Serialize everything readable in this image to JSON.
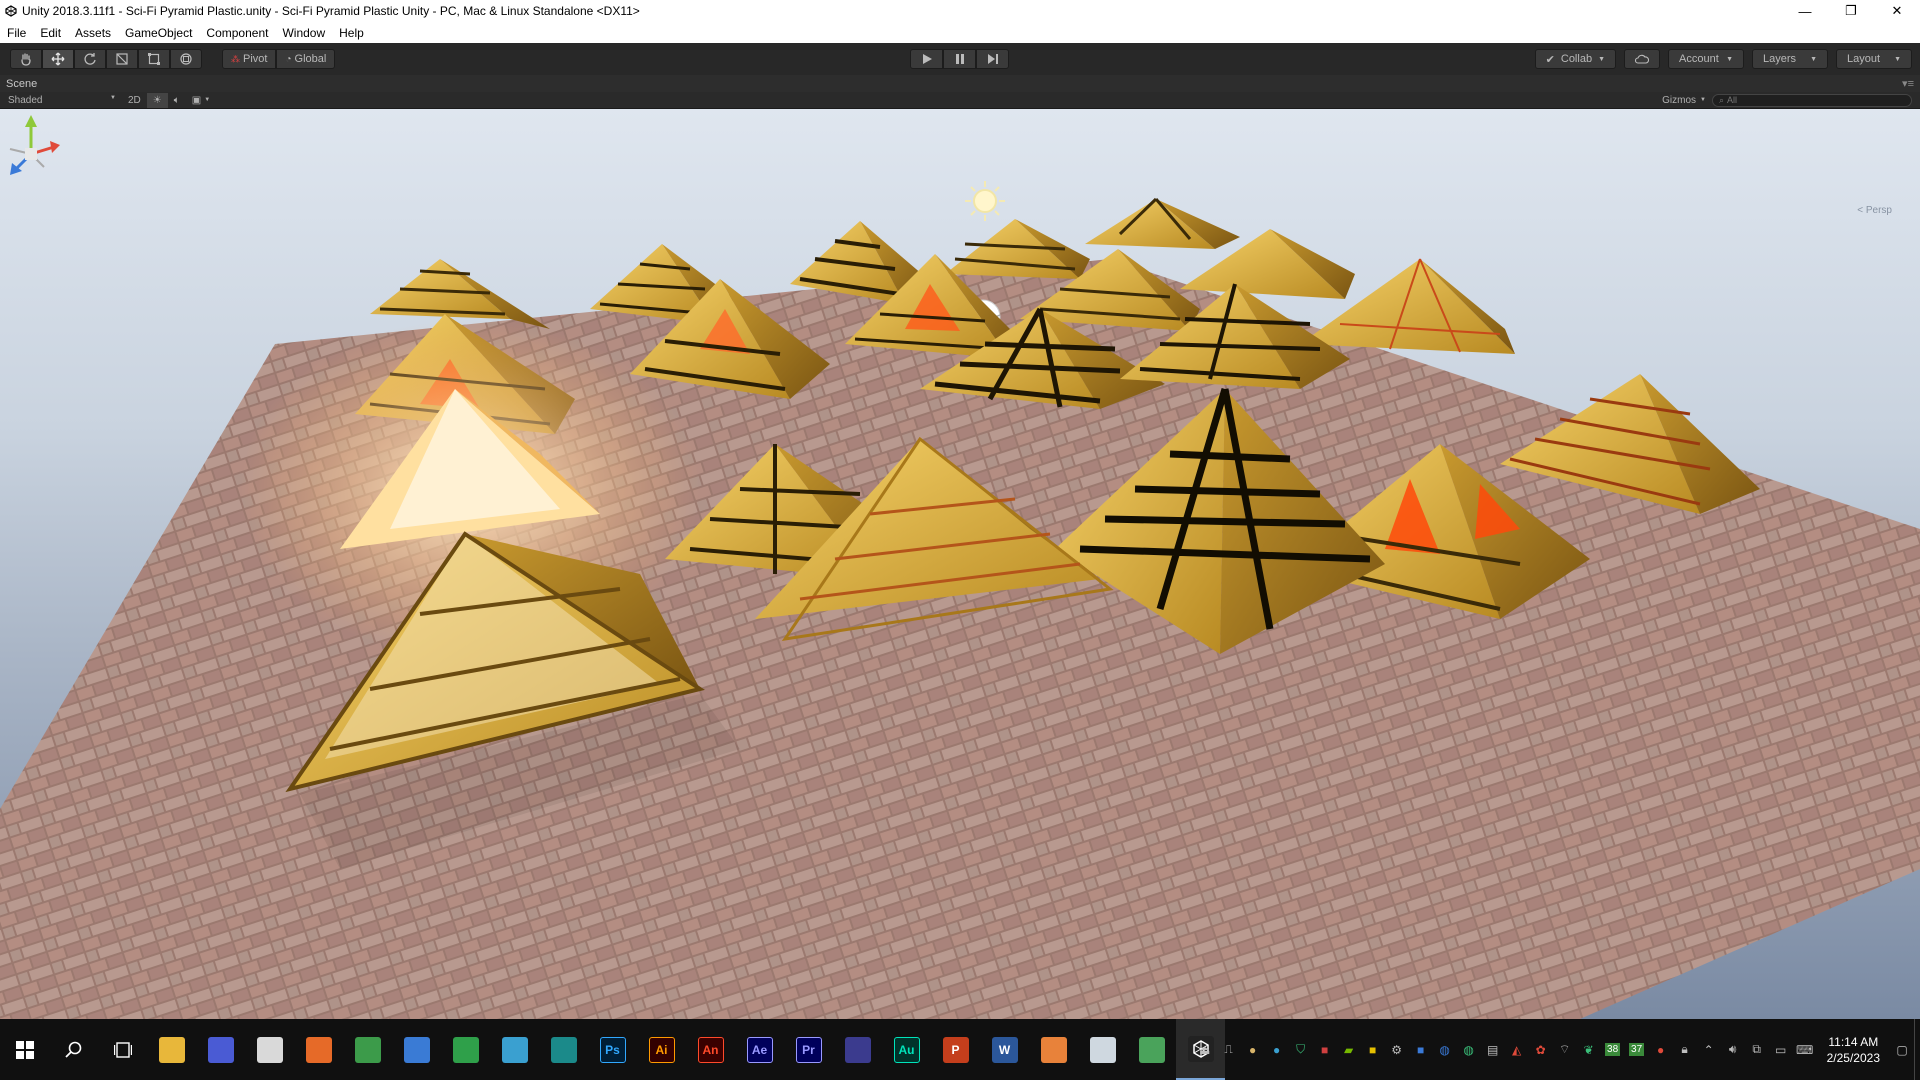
{
  "window": {
    "title": "Unity 2018.3.11f1 - Sci-Fi Pyramid Plastic.unity - Sci-Fi Pyramid Plastic Unity - PC, Mac & Linux Standalone <DX11>",
    "minimize": "—",
    "restore": "❐",
    "close": "✕"
  },
  "menu": [
    "File",
    "Edit",
    "Assets",
    "GameObject",
    "Component",
    "Window",
    "Help"
  ],
  "toolbar": {
    "tools": [
      "hand-icon",
      "move-icon",
      "rotate-icon",
      "scale-icon",
      "rect-icon",
      "transform-icon"
    ],
    "pivot_label": "Pivot",
    "global_label": "Global",
    "collab_label": "Collab",
    "account_label": "Account",
    "layers_label": "Layers",
    "layout_label": "Layout"
  },
  "scene": {
    "tab_label": "Scene",
    "shading_mode": "Shaded",
    "mode_2d": "2D",
    "gizmos_label": "Gizmos",
    "search_placeholder": "All",
    "persp_label": "< Persp"
  },
  "taskbar": {
    "apps": [
      {
        "name": "file-explorer",
        "label": "",
        "color": "#e8b73a"
      },
      {
        "name": "app-generic-blue",
        "label": "",
        "color": "#4a5bd4"
      },
      {
        "name": "app-paint",
        "label": "",
        "color": "#d9d9d9"
      },
      {
        "name": "firefox",
        "label": "",
        "color": "#e66a28"
      },
      {
        "name": "chrome",
        "label": "",
        "color": "#3c9b4a"
      },
      {
        "name": "search-tool",
        "label": "",
        "color": "#3a7bd5"
      },
      {
        "name": "globe-app",
        "label": "",
        "color": "#2fa04a"
      },
      {
        "name": "earth-app",
        "label": "",
        "color": "#3aa0d0"
      },
      {
        "name": "maya",
        "label": "",
        "color": "#1b8a8a"
      },
      {
        "name": "photoshop",
        "label": "Ps",
        "color": "#001e36",
        "fg": "#31a8ff"
      },
      {
        "name": "illustrator",
        "label": "Ai",
        "color": "#330000",
        "fg": "#ff9a00"
      },
      {
        "name": "animate",
        "label": "An",
        "color": "#3a0000",
        "fg": "#ff4a2a"
      },
      {
        "name": "after-effects",
        "label": "Ae",
        "color": "#00005b",
        "fg": "#9999ff"
      },
      {
        "name": "premiere",
        "label": "Pr",
        "color": "#00005b",
        "fg": "#9999ff"
      },
      {
        "name": "app-visual",
        "label": "",
        "color": "#3b3b8e"
      },
      {
        "name": "audition",
        "label": "Au",
        "color": "#00332a",
        "fg": "#00e4bb"
      },
      {
        "name": "powerpoint",
        "label": "P",
        "color": "#c43e1c"
      },
      {
        "name": "word",
        "label": "W",
        "color": "#2b579a"
      },
      {
        "name": "sublime",
        "label": "",
        "color": "#e8823a"
      },
      {
        "name": "notepad",
        "label": "",
        "color": "#cfd8e0"
      },
      {
        "name": "app-green",
        "label": "",
        "color": "#4aa35b"
      },
      {
        "name": "unity",
        "label": "",
        "color": "#222222"
      }
    ],
    "tray_badges": [
      "38",
      "37"
    ],
    "time": "11:14 AM",
    "date": "2/25/2023"
  }
}
